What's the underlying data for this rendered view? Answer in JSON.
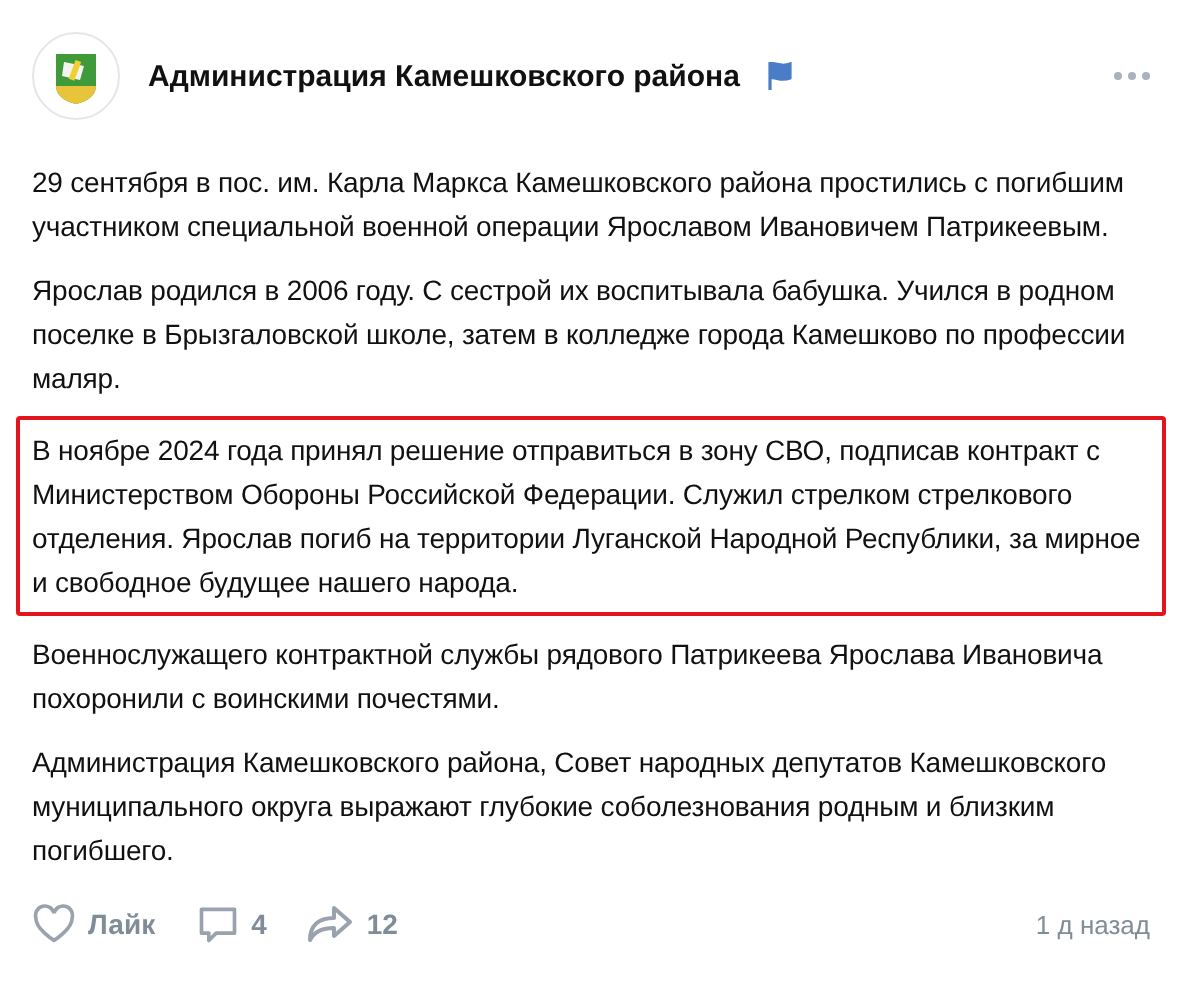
{
  "header": {
    "title": "Администрация Камешковского района"
  },
  "paragraphs": [
    {
      "text": "29 сентября в пос. им. Карла Маркса Камешковского района простились с погибшим участником специальной военной операции Ярославом Ивановичем Патрикеевым.",
      "highlighted": false
    },
    {
      "text": "Ярослав родился в 2006 году. С сестрой их воспитывала бабушка. Учился в родном поселке в Брызгаловской школе, затем в колледже города Камешково по профессии маляр.",
      "highlighted": false
    },
    {
      "text": "В ноябре 2024 года принял решение отправиться в зону СВО, подписав контракт с Министерством Обороны Российской Федерации. Служил стрелком стрелкового отделения. Ярослав погиб на территории Луганской Народной Республики, за мирное и свободное будущее нашего народа.",
      "highlighted": true
    },
    {
      "text": "Военнослужащего контрактной службы рядового Патрикеева Ярослава Ивановича похоронили с воинскими почестями.",
      "highlighted": false
    },
    {
      "text": "Администрация Камешковского района, Совет народных депутатов Камешковского муниципального округа выражают глубокие соболезнования родным и близким погибшего.",
      "highlighted": false
    }
  ],
  "footer": {
    "like": "Лайк",
    "comments": "4",
    "shares": "12",
    "time": "1 д назад"
  }
}
